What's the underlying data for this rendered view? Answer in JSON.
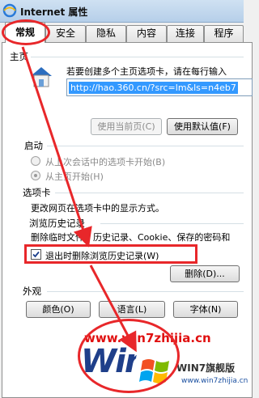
{
  "window": {
    "title": "Internet 属性"
  },
  "tabs": [
    {
      "label": "常规",
      "active": true
    },
    {
      "label": "安全"
    },
    {
      "label": "隐私"
    },
    {
      "label": "内容"
    },
    {
      "label": "连接"
    },
    {
      "label": "程序"
    }
  ],
  "home": {
    "section": "主页",
    "instruction": "若要创建多个主页选项卡，请在每行输入",
    "url": "http://hao.360.cn/?src=lm&ls=n4eb7",
    "use_current": "使用当前页(C)",
    "use_default": "使用默认值(F)"
  },
  "startup": {
    "section": "启动",
    "option1": "从上次会话中的选项卡开始(B)",
    "option2": "从主页开始(H)"
  },
  "tabs_section": {
    "section": "选项卡",
    "text": "更改网页在选项卡中的显示方式。"
  },
  "history": {
    "section": "浏览历史记录",
    "text": "删除临时文件、历史记录、Cookie、保存的密码和",
    "checkbox_label": "退出时删除浏览历史记录(W)",
    "delete_button": "删除(D)..."
  },
  "appearance": {
    "section": "外观",
    "colors": "颜色(O)",
    "languages": "语言(L)",
    "fonts": "字体(N)"
  },
  "watermark": {
    "url": "www.win7zhijia.cn",
    "logo_letters": "Win",
    "badge": "WIN7旗舰版",
    "badge_sub": "www.win7zhijia.cn"
  },
  "colors": {
    "annotation": "#e8272a",
    "selection": "#3399ff"
  }
}
